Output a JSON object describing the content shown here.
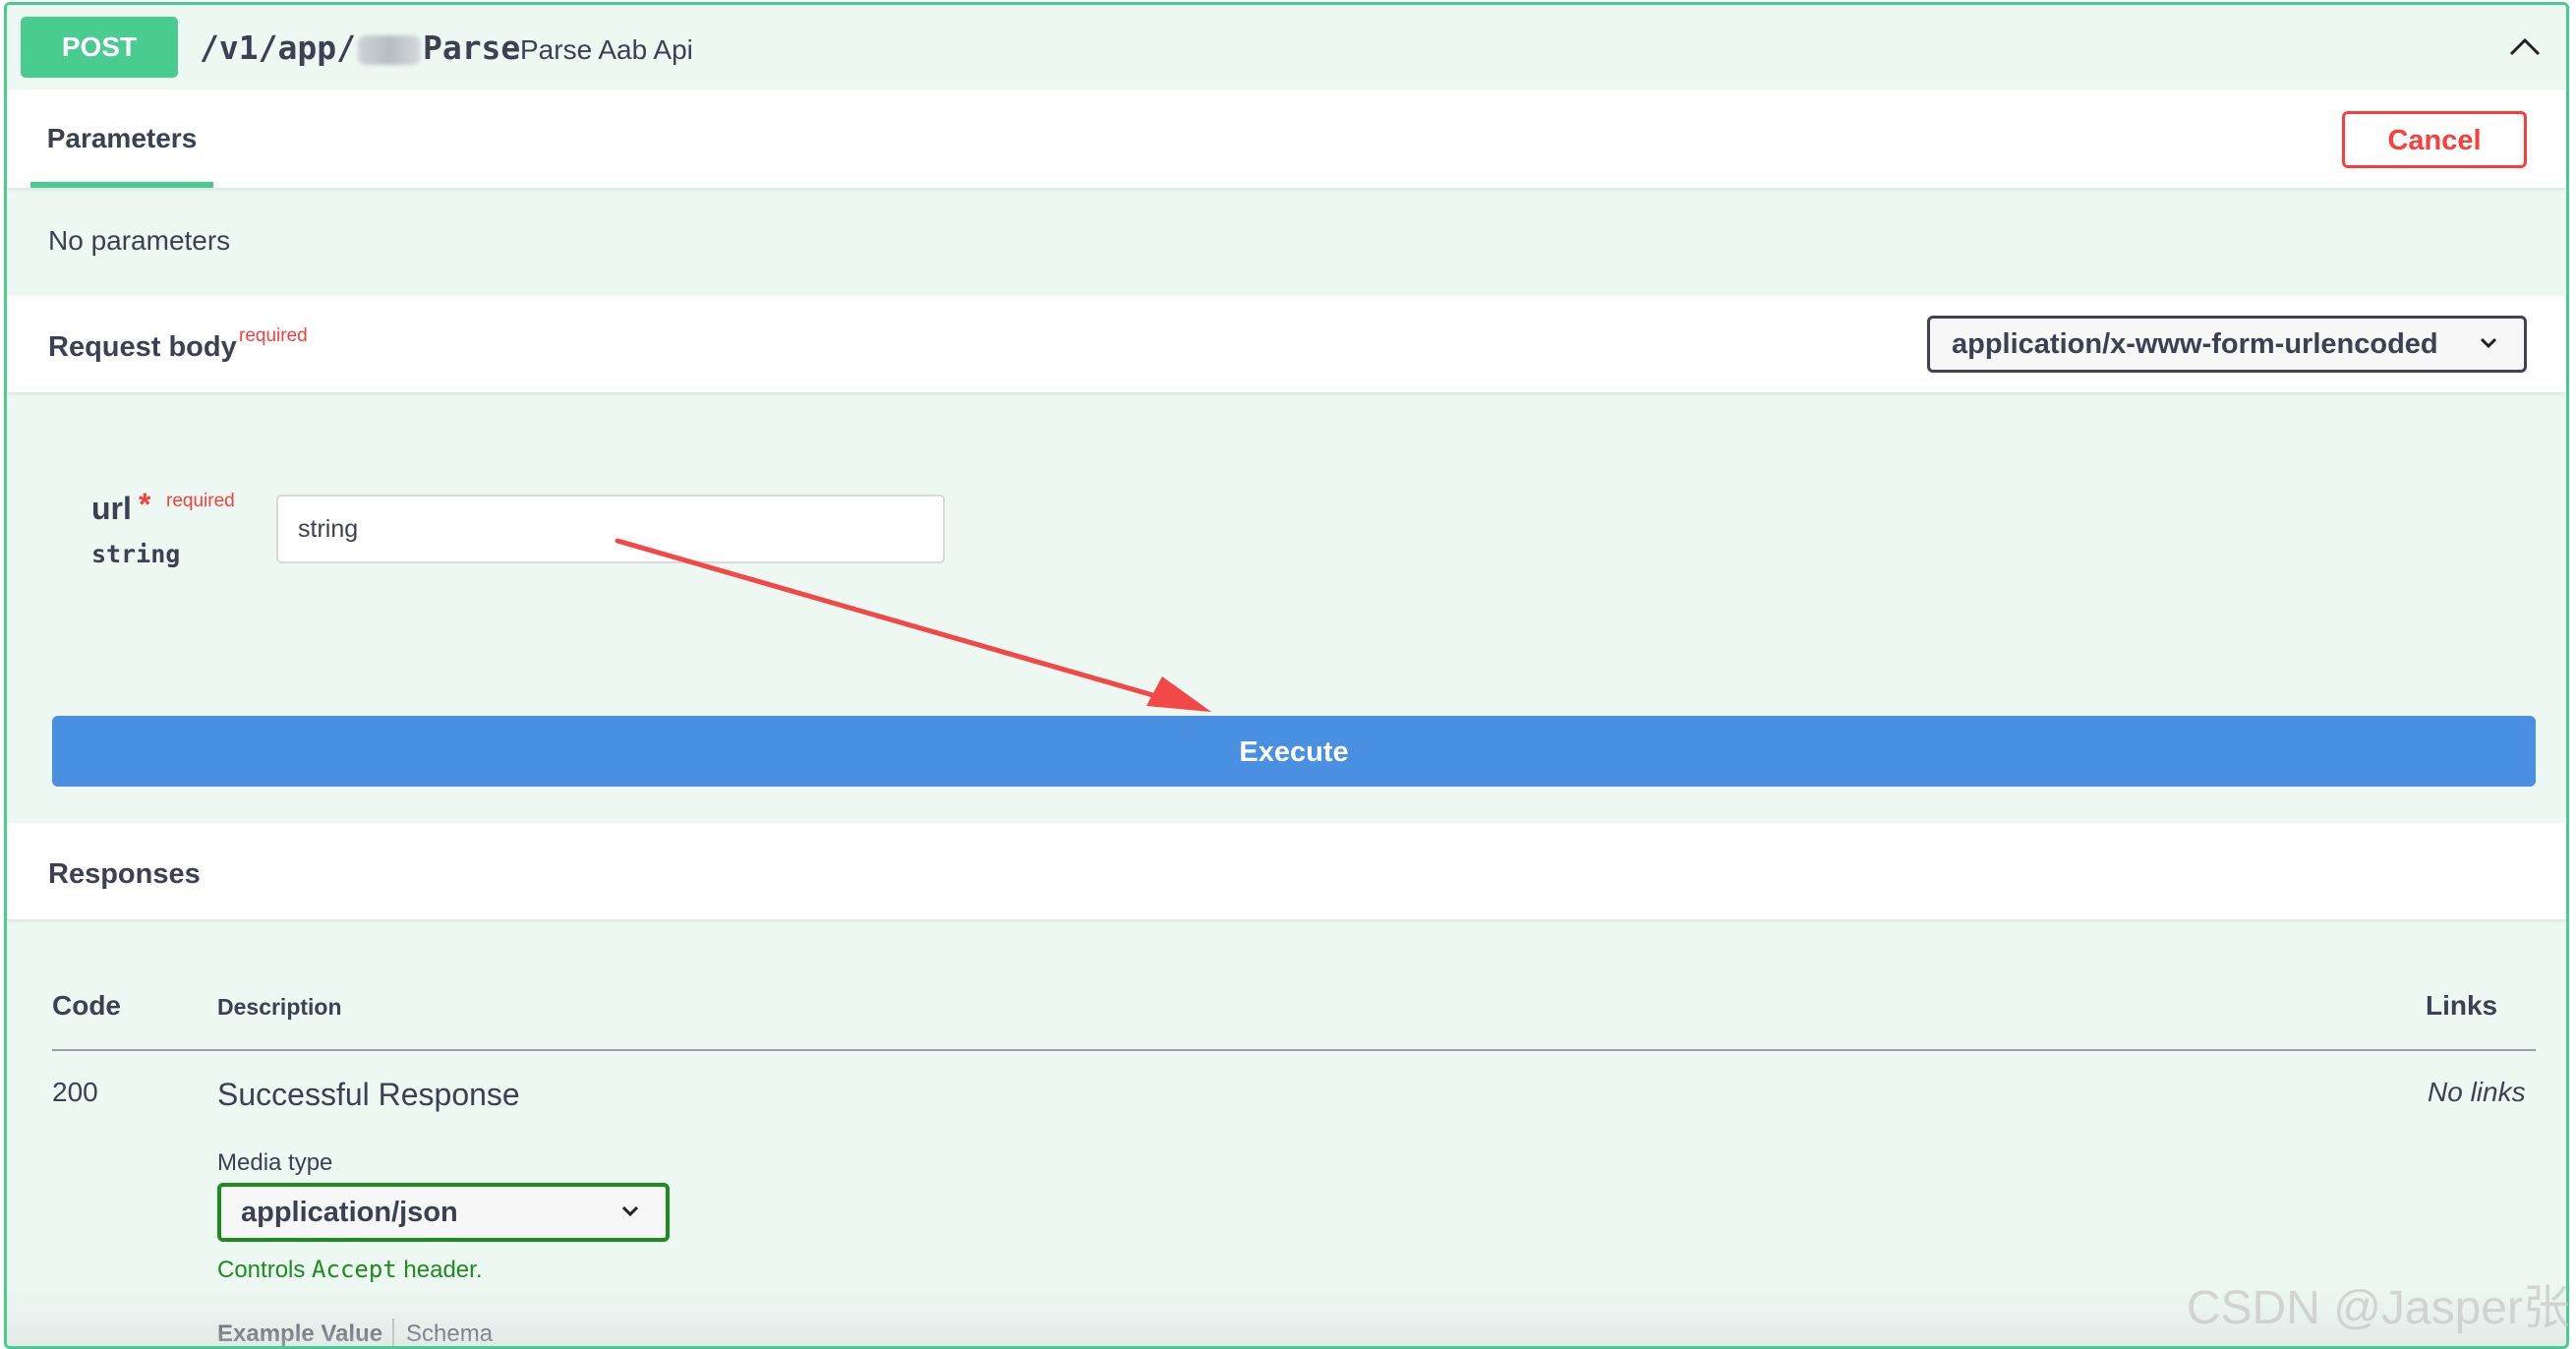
{
  "summary": {
    "method": "POST",
    "path_prefix": "/v1/app/",
    "path_suffix": "Parse",
    "description": "Parse Aab Api"
  },
  "parameters": {
    "tab_label": "Parameters",
    "cancel_label": "Cancel",
    "empty_text": "No parameters"
  },
  "request_body": {
    "title": "Request body",
    "required_label": "required",
    "content_type": "application/x-www-form-urlencoded",
    "field": {
      "name": "url",
      "star": "*",
      "required_label": "required",
      "type": "string",
      "value": "string"
    },
    "execute_label": "Execute"
  },
  "responses": {
    "title": "Responses",
    "columns": {
      "code": "Code",
      "description": "Description",
      "links": "Links"
    },
    "rows": [
      {
        "code": "200",
        "description": "Successful Response",
        "links": "No links",
        "media_type_label": "Media type",
        "media_type": "application/json",
        "controls_prefix": "Controls ",
        "controls_code": "Accept",
        "controls_suffix": " header.",
        "example_tab": "Example Value",
        "schema_tab": "Schema"
      }
    ]
  },
  "watermark": "CSDN @Jasper张",
  "colors": {
    "post": "#49cc90",
    "execute": "#4990e2",
    "cancel": "#f93e3e",
    "required": "#f93e3e",
    "controls_green": "#1e8b1e",
    "annotation_arrow": "#f24848"
  }
}
